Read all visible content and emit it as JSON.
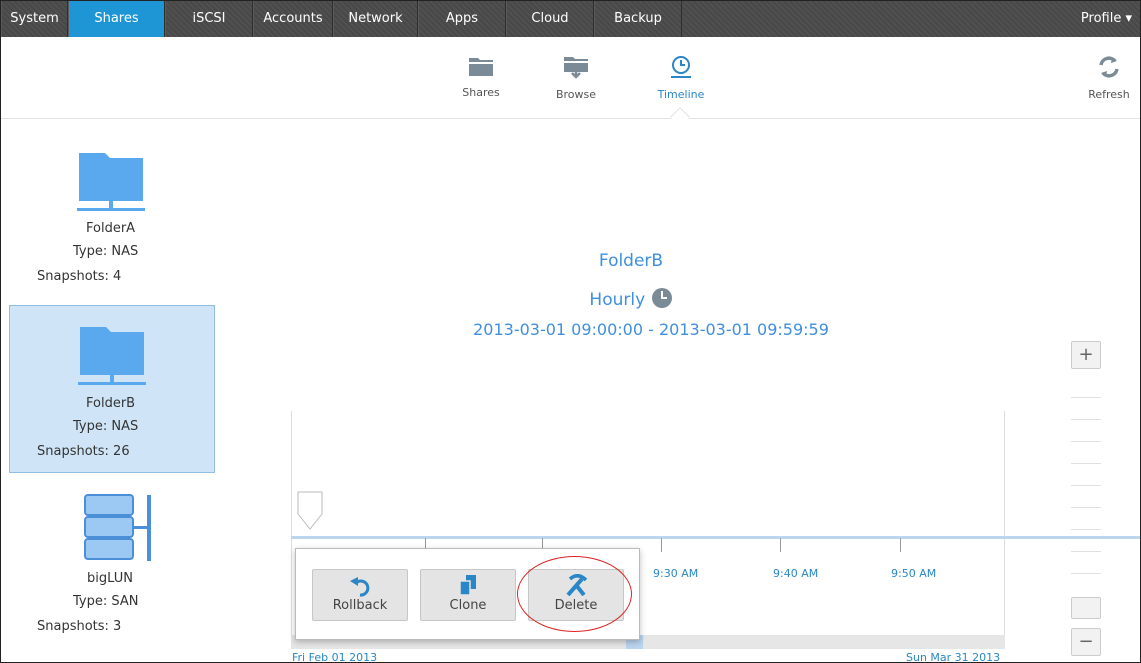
{
  "topnav": {
    "tabs": [
      {
        "label": "System",
        "active": false
      },
      {
        "label": "Shares",
        "active": true
      },
      {
        "label": "iSCSI",
        "active": false
      },
      {
        "label": "Accounts",
        "active": false
      },
      {
        "label": "Network",
        "active": false
      },
      {
        "label": "Apps",
        "active": false
      },
      {
        "label": "Cloud",
        "active": false
      },
      {
        "label": "Backup",
        "active": false
      }
    ],
    "profile_label": "Profile ▾"
  },
  "subbar": {
    "shares_label": "Shares",
    "browse_label": "Browse",
    "timeline_label": "Timeline",
    "refresh_label": "Refresh",
    "active": "Timeline"
  },
  "shares": [
    {
      "name": "FolderA",
      "type": "Type: NAS",
      "snapshots": "Snapshots: 4",
      "icon": "folder-icon",
      "selected": false
    },
    {
      "name": "FolderB",
      "type": "Type: NAS",
      "snapshots": "Snapshots: 26",
      "icon": "folder-icon",
      "selected": true
    },
    {
      "name": "bigLUN",
      "type": "Type: SAN",
      "snapshots": "Snapshots: 3",
      "icon": "lun-icon",
      "selected": false
    }
  ],
  "detail": {
    "title": "FolderB",
    "frequency": "Hourly",
    "range": "2013-03-01 09:00:00  -  2013-03-01 09:59:59"
  },
  "timeline": {
    "tick_labels": [
      "9:30 AM",
      "9:40 AM",
      "9:50 AM"
    ],
    "start_date": "Fri Feb 01 2013",
    "end_date": "Sun Mar 31 2013"
  },
  "popup": {
    "rollback_label": "Rollback",
    "clone_label": "Clone",
    "delete_label": "Delete"
  },
  "zoom": {
    "plus_label": "+",
    "minus_label": "−"
  },
  "colors": {
    "accent": "#1e96d6",
    "folder": "#5aa8ee",
    "text_blue": "#3f8fe0",
    "highlight": "#cfe5f7"
  }
}
